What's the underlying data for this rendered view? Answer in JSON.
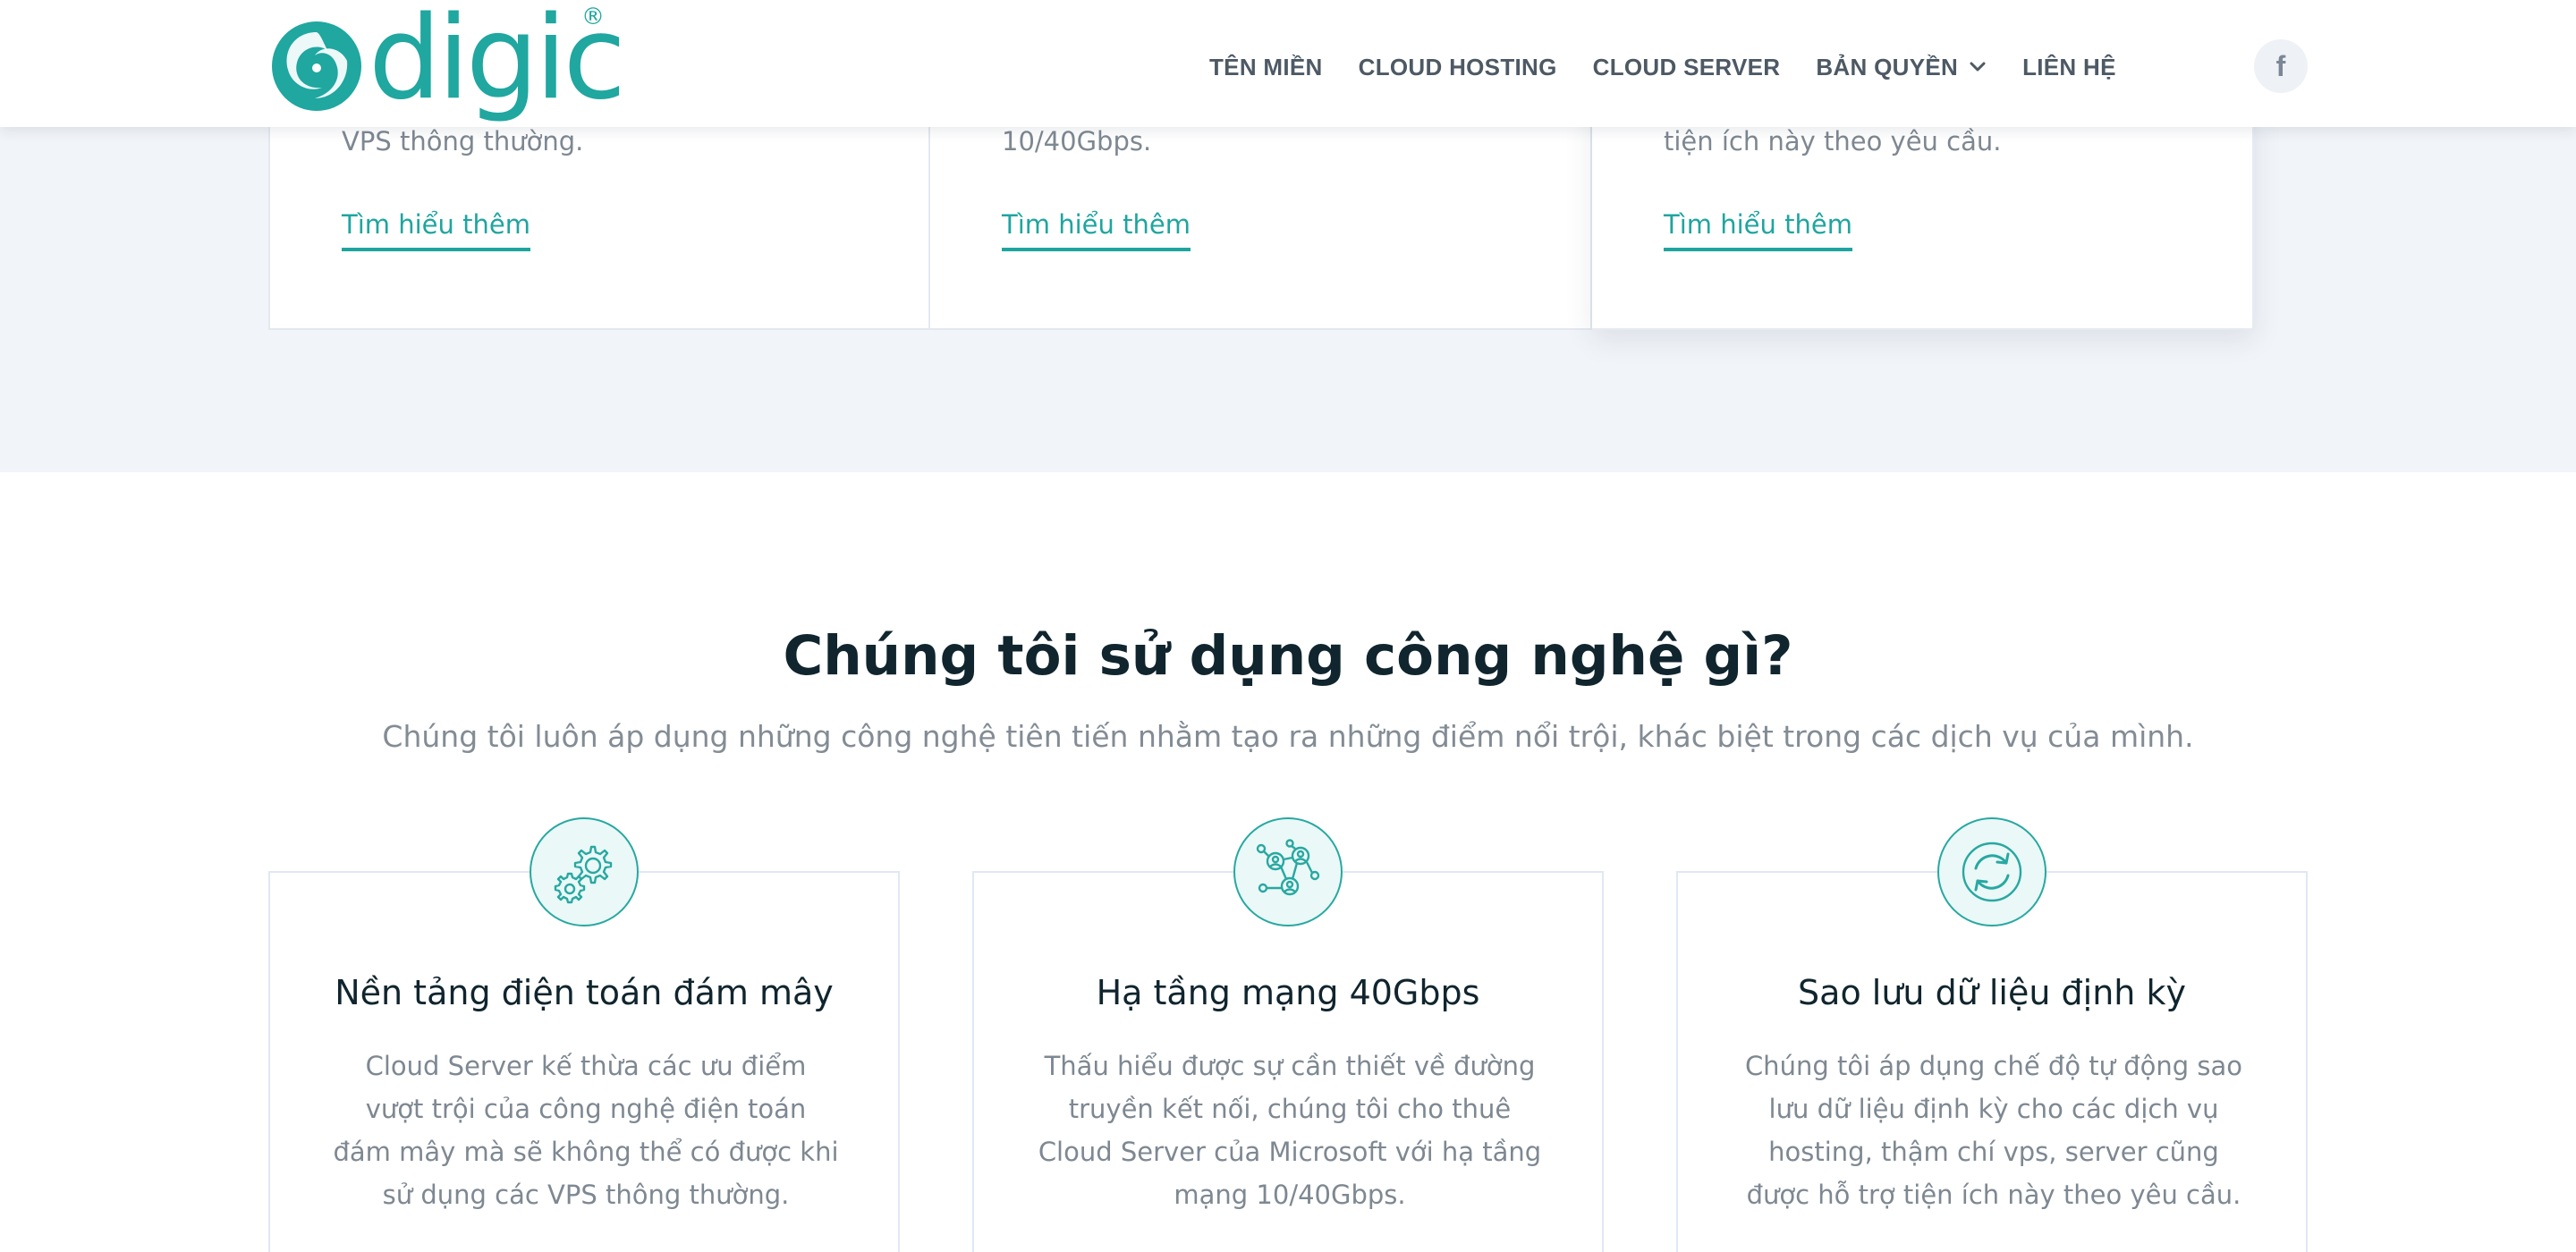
{
  "brand": {
    "name": "digic",
    "registered_mark": "®",
    "color": "#1fa7a0"
  },
  "nav": {
    "items": [
      {
        "label": "TÊN MIỀN"
      },
      {
        "label": "CLOUD HOSTING"
      },
      {
        "label": "CLOUD SERVER"
      },
      {
        "label": "BẢN QUYỀN",
        "has_dropdown": true
      },
      {
        "label": "LIÊN HỆ"
      }
    ],
    "facebook_glyph": "f",
    "facebook_icon": "facebook-icon"
  },
  "top_cards": [
    {
      "desc": "VPS thông thường.",
      "link": "Tìm hiểu thêm"
    },
    {
      "desc": "10/40Gbps.",
      "link": "Tìm hiểu thêm"
    },
    {
      "desc": "tiện ích này theo yêu cầu.",
      "link": "Tìm hiểu thêm"
    }
  ],
  "tech": {
    "title": "Chúng tôi sử dụng công nghệ gì?",
    "subtitle": "Chúng tôi luôn áp dụng những công nghệ tiên tiến nhằm tạo ra những điểm nổi trội, khác biệt trong các dịch vụ của mình.",
    "features": [
      {
        "icon": "gears-icon",
        "title": "Nền tảng điện toán đám mây",
        "desc": "Cloud Server kế thừa các ưu điểm vượt trội của công nghệ điện toán đám mây mà sẽ không thể có được khi sử dụng các VPS thông thường."
      },
      {
        "icon": "network-icon",
        "title": "Hạ tầng mạng 40Gbps",
        "desc": "Thấu hiểu được sự cần thiết về đường truyền kết nối, chúng tôi cho thuê Cloud Server của Microsoft với hạ tầng mạng 10/40Gbps."
      },
      {
        "icon": "sync-icon",
        "title": "Sao lưu dữ liệu định kỳ",
        "desc": "Chúng tôi áp dụng chế độ tự động sao lưu dữ liệu định kỳ cho các dịch vụ hosting, thậm chí vps, server cũng được hỗ trợ tiện ích này theo yêu cầu."
      }
    ]
  },
  "colors": {
    "accent": "#1fa59f",
    "band_background": "#f1f4f8",
    "heading": "#10252e",
    "muted_text": "#7e8892"
  }
}
